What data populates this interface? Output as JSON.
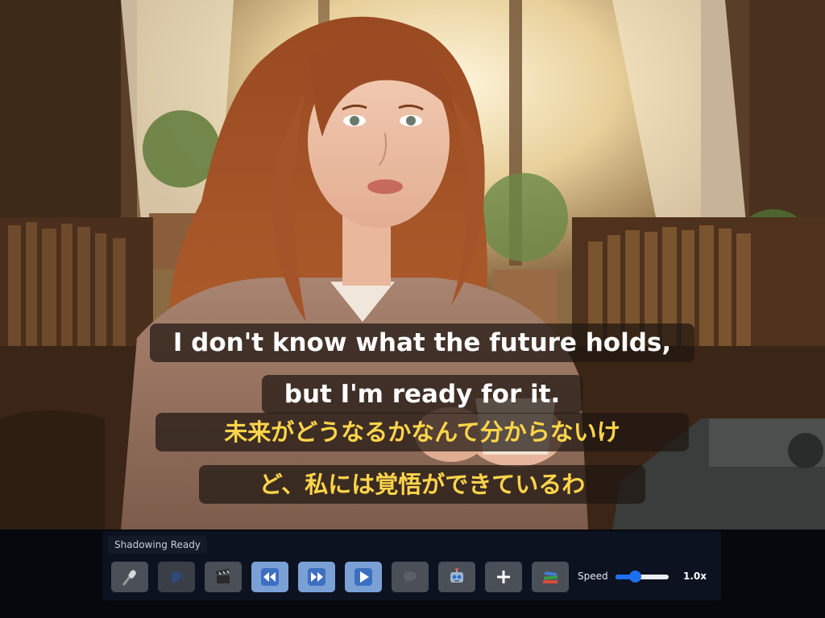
{
  "subtitles": {
    "english": [
      "I don't know what the future holds,",
      "but I'm ready for it."
    ],
    "japanese": [
      "未来がどうなるかなんて分からないけ",
      "ど、私には覚悟ができているわ"
    ]
  },
  "status": {
    "label": "Shadowing Ready"
  },
  "toolbar": {
    "buttons": [
      {
        "icon": "microphone-icon"
      },
      {
        "icon": "speech-head-icon"
      },
      {
        "icon": "clapperboard-icon"
      },
      {
        "icon": "rewind-icon"
      },
      {
        "icon": "fast-forward-icon"
      },
      {
        "icon": "play-icon"
      },
      {
        "icon": "speech-bubble-icon"
      },
      {
        "icon": "robot-icon"
      },
      {
        "icon": "plus-icon"
      },
      {
        "icon": "books-icon"
      }
    ],
    "speed_label": "Speed",
    "speed_value": "1.0x",
    "speed_fraction": 0.37
  },
  "colors": {
    "subtitle_english": "#ffffff",
    "subtitle_japanese": "#ffd54a",
    "slider_accent": "#1e6ff0",
    "button_blue": "#7aa0d6"
  }
}
